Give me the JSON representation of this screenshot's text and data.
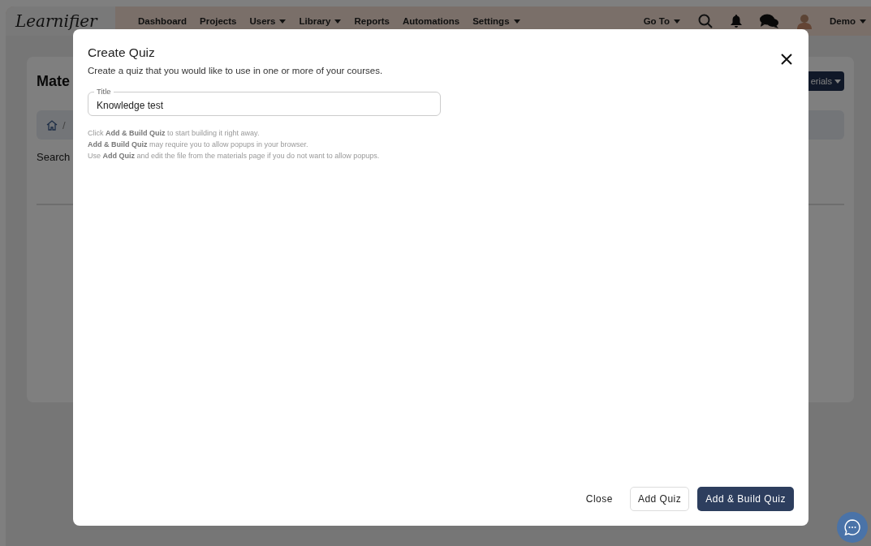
{
  "navbar": {
    "logo": "Learnifier",
    "items": [
      {
        "label": "Dashboard",
        "dropdown": false
      },
      {
        "label": "Projects",
        "dropdown": false
      },
      {
        "label": "Users",
        "dropdown": true
      },
      {
        "label": "Library",
        "dropdown": true
      },
      {
        "label": "Reports",
        "dropdown": false
      },
      {
        "label": "Automations",
        "dropdown": false
      },
      {
        "label": "Settings",
        "dropdown": true
      }
    ],
    "goto": "Go To",
    "user": "Demo"
  },
  "page": {
    "title": "Mate",
    "breadcrumb_separator": "/",
    "search_label": "Search",
    "action_button": "erials"
  },
  "dialog": {
    "title": "Create Quiz",
    "subtitle": "Create a quiz that you would like to use in one or more of your courses.",
    "field": {
      "label": "Title",
      "value": "Knowledge test"
    },
    "help": [
      "Click **Add & Build Quiz** to start building it right away.",
      "**Add & Build Quiz** may require you to allow popups in your browser.",
      "Use **Add Quiz** and edit the file from the materials page if you do not want to allow popups."
    ],
    "buttons": [
      {
        "label": "Close",
        "kind": "text"
      },
      {
        "label": "Add Quiz",
        "kind": "outline"
      },
      {
        "label": "Add & Build Quiz",
        "kind": "primary"
      }
    ]
  }
}
